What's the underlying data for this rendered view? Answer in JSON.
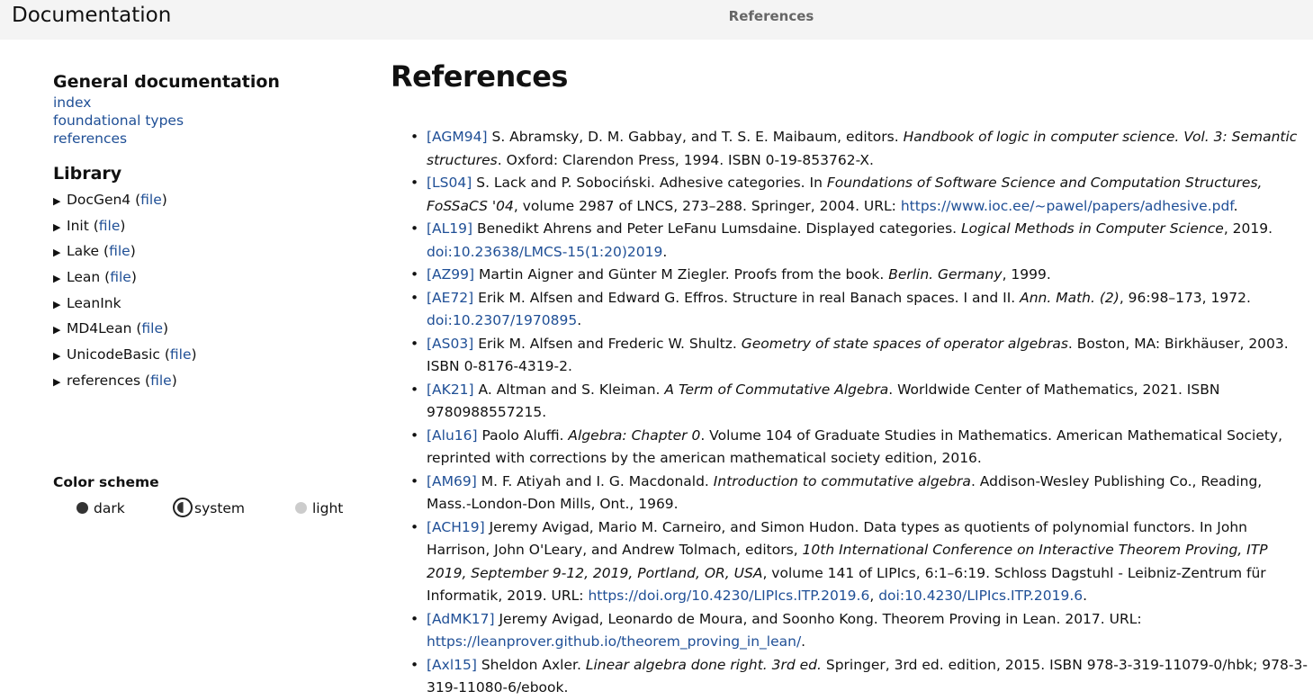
{
  "header": {
    "site_title": "Documentation",
    "page_name": "References"
  },
  "nav": {
    "general_title": "General documentation",
    "general_links": [
      "index",
      "foundational types",
      "references"
    ],
    "library_title": "Library",
    "library_items": [
      {
        "name": "DocGen4",
        "file": "file"
      },
      {
        "name": "Init",
        "file": "file"
      },
      {
        "name": "Lake",
        "file": "file"
      },
      {
        "name": "Lean",
        "file": "file"
      },
      {
        "name": "LeanInk",
        "file": ""
      },
      {
        "name": "MD4Lean",
        "file": "file"
      },
      {
        "name": "UnicodeBasic",
        "file": "file"
      },
      {
        "name": "references",
        "file": "file"
      }
    ]
  },
  "color_scheme": {
    "label": "Color scheme",
    "options": [
      "dark",
      "system",
      "light"
    ],
    "selected": "system"
  },
  "main": {
    "title": "References",
    "references": [
      {
        "tag": "[AGM94]",
        "parts": [
          {
            "t": " S. Abramsky, D. M. Gabbay, and T. S. E. Maibaum, editors. "
          },
          {
            "t": "Handbook of logic in computer science. Vol. 3: Semantic structures",
            "i": true
          },
          {
            "t": ". Oxford: Clarendon Press, 1994. ISBN 0-19-853762-X."
          }
        ]
      },
      {
        "tag": "[LS04]",
        "parts": [
          {
            "t": " S. Lack and P. Sobociński. Adhesive categories. In "
          },
          {
            "t": "Foundations of Software Science and Computation Structures, FoSSaCS '04",
            "i": true
          },
          {
            "t": ", volume 2987 of LNCS, 273–288. Springer, 2004. URL: "
          },
          {
            "t": "https://www.ioc.ee/~pawel/papers/adhesive.pdf",
            "link": true
          },
          {
            "t": "."
          }
        ]
      },
      {
        "tag": "[AL19]",
        "parts": [
          {
            "t": " Benedikt Ahrens and Peter LeFanu Lumsdaine. Displayed categories. "
          },
          {
            "t": "Logical Methods in Computer Science",
            "i": true
          },
          {
            "t": ", 2019. "
          },
          {
            "t": "doi:10.23638/LMCS-15(1:20)2019",
            "link": true
          },
          {
            "t": "."
          }
        ]
      },
      {
        "tag": "[AZ99]",
        "parts": [
          {
            "t": " Martin Aigner and Günter M Ziegler. Proofs from the book. "
          },
          {
            "t": "Berlin. Germany",
            "i": true
          },
          {
            "t": ", 1999."
          }
        ]
      },
      {
        "tag": "[AE72]",
        "parts": [
          {
            "t": " Erik M. Alfsen and Edward G. Effros. Structure in real Banach spaces. I and II. "
          },
          {
            "t": "Ann. Math. (2)",
            "i": true
          },
          {
            "t": ", 96:98–173, 1972. "
          },
          {
            "t": "doi:10.2307/1970895",
            "link": true
          },
          {
            "t": "."
          }
        ]
      },
      {
        "tag": "[AS03]",
        "parts": [
          {
            "t": " Erik M. Alfsen and Frederic W. Shultz. "
          },
          {
            "t": "Geometry of state spaces of operator algebras",
            "i": true
          },
          {
            "t": ". Boston, MA: Birkhäuser, 2003. ISBN 0-8176-4319-2."
          }
        ]
      },
      {
        "tag": "[AK21]",
        "parts": [
          {
            "t": " A. Altman and S. Kleiman. "
          },
          {
            "t": "A Term of Commutative Algebra",
            "i": true
          },
          {
            "t": ". Worldwide Center of Mathematics, 2021. ISBN 9780988557215."
          }
        ]
      },
      {
        "tag": "[Alu16]",
        "parts": [
          {
            "t": " Paolo Aluffi. "
          },
          {
            "t": "Algebra: Chapter 0",
            "i": true
          },
          {
            "t": ". Volume 104 of Graduate Studies in Mathematics. American Mathematical Society, reprinted with corrections by the american mathematical society edition, 2016."
          }
        ]
      },
      {
        "tag": "[AM69]",
        "parts": [
          {
            "t": " M. F. Atiyah and I. G. Macdonald. "
          },
          {
            "t": "Introduction to commutative algebra",
            "i": true
          },
          {
            "t": ". Addison-Wesley Publishing Co., Reading, Mass.-London-Don Mills, Ont., 1969."
          }
        ]
      },
      {
        "tag": "[ACH19]",
        "parts": [
          {
            "t": " Jeremy Avigad, Mario M. Carneiro, and Simon Hudon. Data types as quotients of polynomial functors. In John Harrison, John O'Leary, and Andrew Tolmach, editors, "
          },
          {
            "t": "10th International Conference on Interactive Theorem Proving, ITP 2019, September 9-12, 2019, Portland, OR, USA",
            "i": true
          },
          {
            "t": ", volume 141 of LIPIcs, 6:1–6:19. Schloss Dagstuhl - Leibniz-Zentrum für Informatik, 2019. URL: "
          },
          {
            "t": "https://doi.org/10.4230/LIPIcs.ITP.2019.6",
            "link": true
          },
          {
            "t": ", "
          },
          {
            "t": "doi:10.4230/LIPIcs.ITP.2019.6",
            "link": true
          },
          {
            "t": "."
          }
        ]
      },
      {
        "tag": "[AdMK17]",
        "parts": [
          {
            "t": " Jeremy Avigad, Leonardo de Moura, and Soonho Kong. Theorem Proving in Lean. 2017. URL: "
          },
          {
            "t": "https://leanprover.github.io/theorem_proving_in_lean/",
            "link": true
          },
          {
            "t": "."
          }
        ]
      },
      {
        "tag": "[Axl15]",
        "parts": [
          {
            "t": " Sheldon Axler. "
          },
          {
            "t": "Linear algebra done right. 3rd ed.",
            "i": true
          },
          {
            "t": " Springer, 3rd ed. edition, 2015. ISBN 978-3-319-11079-0/hbk; 978-3-319-11080-6/ebook."
          }
        ]
      }
    ]
  }
}
